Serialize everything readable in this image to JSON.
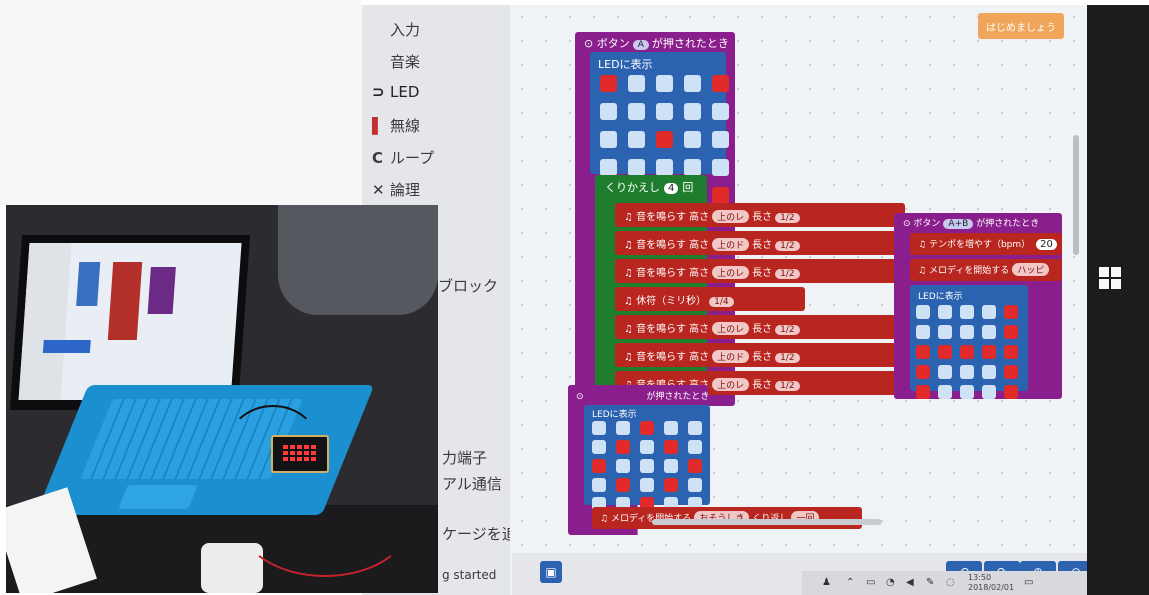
{
  "categories": [
    {
      "icon": "",
      "label": "入力"
    },
    {
      "icon": "",
      "label": "音楽"
    },
    {
      "icon": "⊃",
      "label": "LED"
    },
    {
      "icon": "▌",
      "label": "無線"
    },
    {
      "icon": "C",
      "label": "ループ"
    },
    {
      "icon": "✕",
      "label": "論理"
    }
  ],
  "partial_menu": {
    "block": "ブロック",
    "pins": "力端子",
    "serial": "アル通信",
    "add_package": "ケージを追加する",
    "getting_started": "g started"
  },
  "start_button": "はじめましょう",
  "block_a": {
    "header_prefix": "ボタン",
    "button": "A",
    "header_suffix": "が押されたとき",
    "led_label": "LEDに表示",
    "led_pattern": [
      [
        1,
        0,
        0,
        0,
        1
      ],
      [
        0,
        0,
        0,
        0,
        0
      ],
      [
        0,
        0,
        1,
        0,
        0
      ],
      [
        0,
        0,
        0,
        0,
        0
      ],
      [
        1,
        0,
        0,
        0,
        1
      ]
    ],
    "repeat_label": "くりかえし",
    "repeat_count": "4",
    "repeat_unit": "回",
    "tones": [
      {
        "kind": "tone",
        "label": "音を鳴らす 高さ",
        "note": "上のレ",
        "len_label": "長さ",
        "len": "1/2"
      },
      {
        "kind": "tone",
        "label": "音を鳴らす 高さ",
        "note": "上のド",
        "len_label": "長さ",
        "len": "1/2"
      },
      {
        "kind": "tone",
        "label": "音を鳴らす 高さ",
        "note": "上のレ",
        "len_label": "長さ",
        "len": "1/2"
      },
      {
        "kind": "rest",
        "label": "休符（ミリ秒）",
        "len": "1/4"
      },
      {
        "kind": "tone",
        "label": "音を鳴らす 高さ",
        "note": "上のレ",
        "len_label": "長さ",
        "len": "1/2"
      },
      {
        "kind": "tone",
        "label": "音を鳴らす 高さ",
        "note": "上のド",
        "len_label": "長さ",
        "len": "1/2"
      },
      {
        "kind": "tone",
        "label": "音を鳴らす 高さ",
        "note": "上のレ",
        "len_label": "長さ",
        "len": "1/2"
      }
    ]
  },
  "block_ab": {
    "header_prefix": "ボタン",
    "button": "A+B",
    "header_suffix": "が押されたとき",
    "tempo_label": "テンポを増やす（bpm）",
    "tempo_value": "20",
    "melody_label": "メロディを開始する",
    "melody_value": "ハッピ",
    "led_label": "LEDに表示",
    "led_pattern": [
      [
        0,
        0,
        0,
        0,
        1
      ],
      [
        0,
        0,
        0,
        0,
        1
      ],
      [
        1,
        1,
        1,
        1,
        1
      ],
      [
        1,
        0,
        0,
        0,
        1
      ],
      [
        1,
        0,
        0,
        0,
        1
      ]
    ]
  },
  "block_b": {
    "header_suffix": "が押されたとき",
    "led_label": "LEDに表示",
    "led_pattern": [
      [
        0,
        0,
        1,
        0,
        0
      ],
      [
        0,
        1,
        0,
        1,
        0
      ],
      [
        1,
        0,
        0,
        0,
        1
      ],
      [
        0,
        1,
        0,
        1,
        0
      ],
      [
        0,
        0,
        1,
        0,
        0
      ]
    ],
    "melody_label": "メロディを開始する",
    "melody_value": "おそうしき",
    "repeat_label": "くり返し",
    "repeat_value": "一回"
  },
  "taskbar": {
    "time": "13:50",
    "date": "2018/02/01"
  },
  "colors": {
    "event_purple": "#8a1e8c",
    "led_blue": "#2c63b0",
    "loop_green": "#1e7e2d",
    "music_red": "#b9251f",
    "start_orange": "#f0a55a"
  }
}
